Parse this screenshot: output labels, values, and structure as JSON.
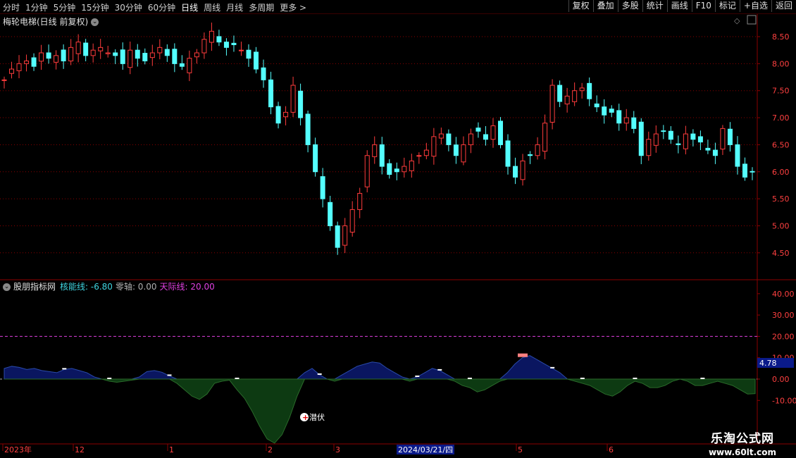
{
  "toolbar": {
    "periods": [
      "分时",
      "1分钟",
      "5分钟",
      "15分钟",
      "30分钟",
      "60分钟",
      "日线",
      "周线",
      "月线",
      "多周期",
      "更多 >"
    ],
    "active_period": "日线",
    "right_buttons": [
      "复权",
      "叠加",
      "多股",
      "统计",
      "画线",
      "F10",
      "标记",
      "+自选",
      "返回"
    ]
  },
  "stock": {
    "title": "梅轮电梯(日线 前复权)"
  },
  "price_axis": {
    "ticks": [
      "8.50",
      "8.00",
      "7.50",
      "7.00",
      "6.50",
      "6.00",
      "5.50",
      "5.00",
      "4.50"
    ]
  },
  "indicator": {
    "name": "股朋指标网",
    "core_line": "核能线: -6.80",
    "zero_axis": "零轴: 0.00",
    "sky_line": "天际线: 20.00",
    "current_value": "4.78",
    "axis_ticks": [
      "40.00",
      "30.00",
      "20.00",
      "10.00",
      "0.00",
      "-10.00"
    ],
    "signal_label": "潜伏"
  },
  "time_axis": {
    "labels": [
      "2023年",
      "12",
      "1",
      "2",
      "3",
      "5",
      "6"
    ],
    "cursor_date": "2024/03/21/四"
  },
  "watermark": {
    "line1": "乐淘公式网",
    "line2": "www.60lt.com"
  },
  "colors": {
    "up": "#ff3c3c",
    "down": "#54ffff",
    "sky_line": "#e040e0",
    "core_pos": "#0a1660",
    "core_neg": "#0d3a12"
  }
}
